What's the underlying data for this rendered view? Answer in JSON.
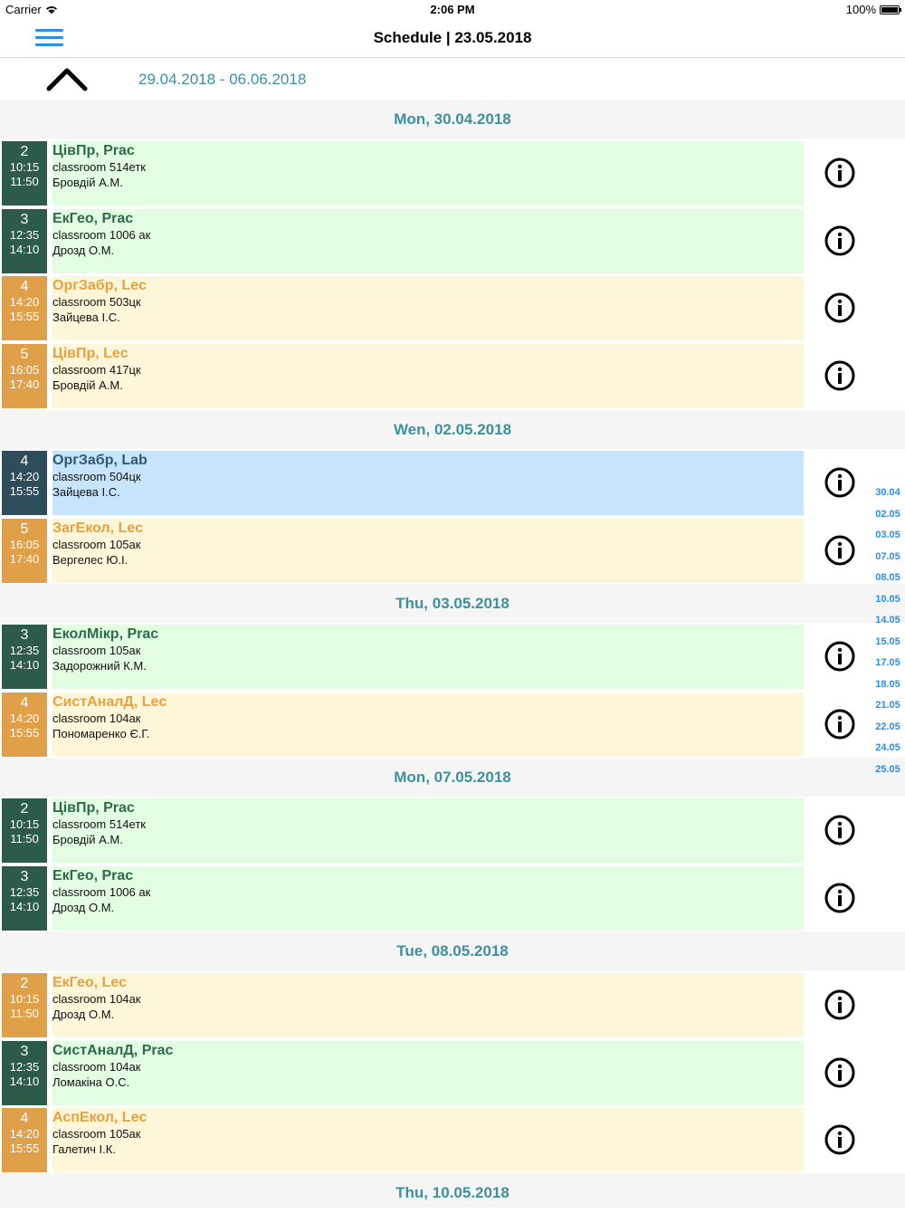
{
  "statusbar": {
    "carrier": "Carrier",
    "time": "2:06 PM",
    "battery": "100%"
  },
  "navbar": {
    "title": "Schedule | 23.05.2018"
  },
  "range": {
    "text": "29.04.2018 - 06.06.2018"
  },
  "days": [
    {
      "header": "Mon, 30.04.2018"
    },
    {
      "header": "Wen, 02.05.2018"
    },
    {
      "header": "Thu, 03.05.2018"
    },
    {
      "header": "Mon, 07.05.2018"
    },
    {
      "header": "Tue, 08.05.2018"
    },
    {
      "header": "Thu, 10.05.2018"
    }
  ],
  "lessons": [
    {
      "num": "2",
      "start": "10:15",
      "end": "11:50",
      "subject": "ЦівПр, Prac",
      "room": "classroom  514етк",
      "teacher": "Бровдій А.М."
    },
    {
      "num": "3",
      "start": "12:35",
      "end": "14:10",
      "subject": "ЕкГео, Prac",
      "room": "classroom  1006 ак",
      "teacher": "Дрозд О.М."
    },
    {
      "num": "4",
      "start": "14:20",
      "end": "15:55",
      "subject": "ОргЗабр, Lec",
      "room": "classroom  503цк",
      "teacher": "Зайцева І.С."
    },
    {
      "num": "5",
      "start": "16:05",
      "end": "17:40",
      "subject": "ЦівПр, Lec",
      "room": "classroom  417цк",
      "teacher": "Бровдій А.М."
    },
    {
      "num": "4",
      "start": "14:20",
      "end": "15:55",
      "subject": "ОргЗабр, Lab",
      "room": "classroom  504цк",
      "teacher": "Зайцева І.С."
    },
    {
      "num": "5",
      "start": "16:05",
      "end": "17:40",
      "subject": "ЗагЕкол, Lec",
      "room": "classroom  105ак",
      "teacher": "Вергелес Ю.І."
    },
    {
      "num": "3",
      "start": "12:35",
      "end": "14:10",
      "subject": "ЕколМікр, Prac",
      "room": "classroom  105ак",
      "teacher": "Задорожний К.М."
    },
    {
      "num": "4",
      "start": "14:20",
      "end": "15:55",
      "subject": "СистАналД, Lec",
      "room": "classroom  104ак",
      "teacher": "Пономаренко Є.Г."
    },
    {
      "num": "2",
      "start": "10:15",
      "end": "11:50",
      "subject": "ЦівПр, Prac",
      "room": "classroom  514етк",
      "teacher": "Бровдій А.М."
    },
    {
      "num": "3",
      "start": "12:35",
      "end": "14:10",
      "subject": "ЕкГео, Prac",
      "room": "classroom  1006 ак",
      "teacher": "Дрозд О.М."
    },
    {
      "num": "2",
      "start": "10:15",
      "end": "11:50",
      "subject": "ЕкГео, Lec",
      "room": "classroom  104ак",
      "teacher": "Дрозд О.М."
    },
    {
      "num": "3",
      "start": "12:35",
      "end": "14:10",
      "subject": "СистАналД, Prac",
      "room": "classroom  104ак",
      "teacher": "Ломакіна О.С."
    },
    {
      "num": "4",
      "start": "14:20",
      "end": "15:55",
      "subject": "АспЕкол, Lec",
      "room": "classroom  105ак",
      "teacher": "Галетич І.К."
    }
  ],
  "date_index": [
    "30.04",
    "02.05",
    "03.05",
    "07.05",
    "08.05",
    "10.05",
    "14.05",
    "15.05",
    "17.05",
    "18.05",
    "21.05",
    "22.05",
    "24.05",
    "25.05"
  ],
  "colors": {
    "accent": "#2b8ee6",
    "header_text": "#3e8f9f",
    "prac_badge": "#2d5b4a",
    "lec_badge": "#e0a04a",
    "lab_badge": "#2d4d5b",
    "prac_card": "#e2fde2",
    "lec_card": "#fdf6d8",
    "lab_card": "#c6e4fb"
  }
}
